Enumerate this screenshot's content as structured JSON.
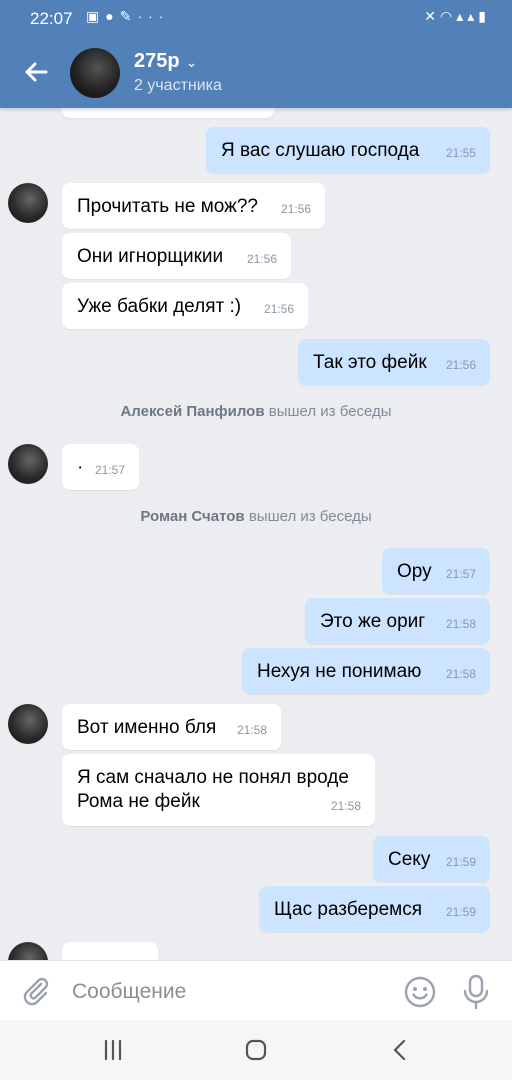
{
  "status_bar": {
    "time": "22:07",
    "left_icons": [
      "image-icon",
      "chat-icon",
      "wrench-icon",
      "more-icon"
    ],
    "right_icons": [
      "mute-icon",
      "wifi-icon",
      "signal-icon",
      "signal-icon",
      "battery-icon"
    ]
  },
  "header": {
    "title": "275р",
    "subtitle": "2 участника"
  },
  "messages": [
    {
      "dir": "out",
      "text": "Я вас слушаю господа",
      "time": "21:55"
    },
    {
      "dir": "in",
      "text": "Прочитать не мож??",
      "time": "21:56"
    },
    {
      "dir": "in",
      "text": "Они игнорщикии",
      "time": "21:56"
    },
    {
      "dir": "in",
      "text": "Уже бабки делят :)",
      "time": "21:56"
    },
    {
      "dir": "out",
      "text": "Так это фейк",
      "time": "21:56"
    },
    {
      "dir": "in",
      "text": "·",
      "time": "21:57"
    },
    {
      "dir": "out",
      "text": "Ору",
      "time": "21:57"
    },
    {
      "dir": "out",
      "text": "Это же ориг",
      "time": "21:58"
    },
    {
      "dir": "out",
      "text": "Нехуя не понимаю",
      "time": "21:58"
    },
    {
      "dir": "in",
      "text": "Вот именно бля",
      "time": "21:58"
    },
    {
      "dir": "in",
      "text": "Я сам сначало не понял вроде\nРома не фейк",
      "time": "21:58"
    },
    {
      "dir": "out",
      "text": "Секу",
      "time": "21:59"
    },
    {
      "dir": "out",
      "text": "Щас разберемся",
      "time": "21:59"
    }
  ],
  "service_messages": [
    {
      "name": "Алексей Панфилов",
      "action": "вышел из беседы"
    },
    {
      "name": "Роман Счатов",
      "action": "вышел из беседы"
    }
  ],
  "composer": {
    "placeholder": "Сообщение"
  },
  "colors": {
    "header": "#5181b8",
    "background": "#ebedf0",
    "bubble_in": "#ffffff",
    "bubble_out": "#cce4ff"
  }
}
